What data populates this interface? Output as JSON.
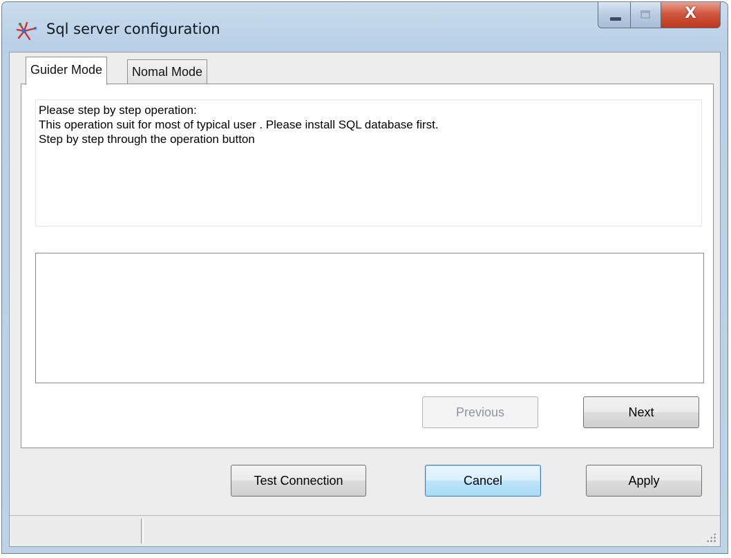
{
  "window": {
    "title": "Sql server configuration",
    "app_icon": "sql-config-app-icon",
    "controls": {
      "minimize_icon": "minimize-icon",
      "maximize_icon": "maximize-icon",
      "close_glyph": "X"
    }
  },
  "tabs": [
    {
      "label": "Guider Mode",
      "active": true
    },
    {
      "label": "Nomal Mode",
      "active": false
    }
  ],
  "guider": {
    "instructions": [
      "Please step by step operation:",
      "This  operation suit for most of  typical user . Please  install SQL database first.",
      "Step by step through the operation button"
    ],
    "output_text": "",
    "previous_label": "Previous",
    "next_label": "Next"
  },
  "footer": {
    "test_connection_label": "Test Connection",
    "cancel_label": "Cancel",
    "apply_label": "Apply"
  },
  "statusbar": {
    "text": ""
  },
  "colors": {
    "title_frame": "#bcd3e8",
    "close_button": "#c94a33",
    "default_button_border": "#3c7fb1",
    "disabled_text": "#8a96a6"
  }
}
